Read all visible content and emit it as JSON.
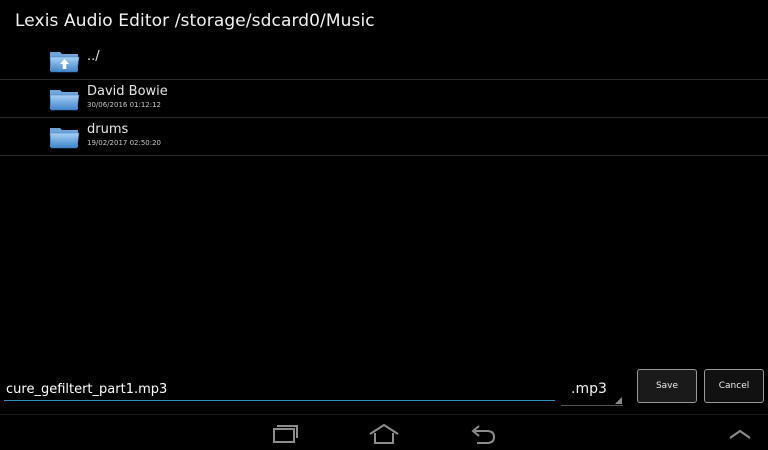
{
  "header": {
    "title": "Lexis Audio Editor  /storage/sdcard0/Music"
  },
  "files": [
    {
      "name": "../",
      "date": "",
      "icon": "folder-up-icon"
    },
    {
      "name": "David Bowie",
      "date": "30/06/2016 01:12:12",
      "icon": "folder-icon"
    },
    {
      "name": "drums",
      "date": "19/02/2017 02:50:20",
      "icon": "folder-icon"
    }
  ],
  "save_bar": {
    "filename_value": "cure_gefiltert_part1.mp3",
    "extension": ".mp3",
    "save_label": "Save",
    "cancel_label": "Cancel"
  },
  "colors": {
    "background": "#000000",
    "accent": "#2f8fc0",
    "folder_blue": "#5b9ad5"
  }
}
